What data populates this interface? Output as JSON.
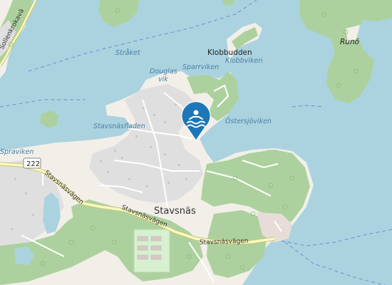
{
  "map": {
    "labels": {
      "town": "Stavsnäs",
      "klobbudden": "Klobbudden",
      "runo": "Runö",
      "strakets": "Stråket",
      "douglas_1": "Douglas",
      "douglas_2": "vik",
      "sparrviken": "Sparrviken",
      "klobbviken": "Klobbviken",
      "stavsnasfladen": "Stavsnäsfladen",
      "ostersjoviken": "Östersjöviken",
      "spraviken": "Spraviken",
      "sollenkrokavagen": "Sollenkrokavä",
      "stavsnasvagen_1": "Stavsnäsvägen",
      "stavsnasvagen_2": "Stavsnäsvägen",
      "stavsnasvagen_3": "Stavsnäsvägen"
    },
    "route_shield": "222",
    "marker": {
      "icon": "swimming-icon",
      "color": "#1d76b8"
    },
    "colors": {
      "water": "#aad3df",
      "land": "#f2efe9",
      "forest": "#add19e",
      "residential": "#e0dfdf",
      "road_major": "#f7fabf",
      "road_minor": "#ffffff",
      "ferry": "#6a8fd8"
    }
  }
}
